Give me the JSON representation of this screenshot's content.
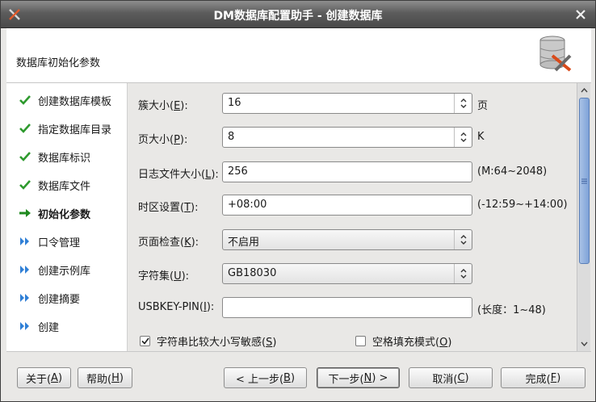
{
  "window": {
    "title": "DM数据库配置助手 - 创建数据库"
  },
  "header": {
    "title": "数据库初始化参数",
    "logo_icon": "database-config-icon"
  },
  "steps": [
    {
      "label": "创建数据库模板",
      "state": "done"
    },
    {
      "label": "指定数据库目录",
      "state": "done"
    },
    {
      "label": "数据库标识",
      "state": "done"
    },
    {
      "label": "数据库文件",
      "state": "done"
    },
    {
      "label": "初始化参数",
      "state": "current"
    },
    {
      "label": "口令管理",
      "state": "pending"
    },
    {
      "label": "创建示例库",
      "state": "pending"
    },
    {
      "label": "创建摘要",
      "state": "pending"
    },
    {
      "label": "创建",
      "state": "pending"
    }
  ],
  "form": {
    "extent_size": {
      "label": "簇大小(",
      "key": "E",
      "label_end": "):",
      "value": "16",
      "suffix": "页"
    },
    "page_size": {
      "label": "页大小(",
      "key": "P",
      "label_end": "):",
      "value": "8",
      "suffix": "K"
    },
    "log_size": {
      "label": "日志文件大小(",
      "key": "L",
      "label_end": "):",
      "value": "256",
      "suffix": "(M:64~2048)"
    },
    "time_zone": {
      "label": "时区设置(",
      "key": "T",
      "label_end": "):",
      "value": "+08:00",
      "suffix": "(-12:59~+14:00)"
    },
    "page_check": {
      "label": "页面检查(",
      "key": "K",
      "label_end": "):",
      "value": "不启用"
    },
    "charset": {
      "label": "字符集(",
      "key": "U",
      "label_end": "):",
      "value": "GB18030"
    },
    "usbkey_pin": {
      "label": "USBKEY-PIN(",
      "key": "I",
      "label_end": "):",
      "value": "",
      "suffix": "(长度：1~48)"
    },
    "case_sensitive": {
      "label": "字符串比较大小写敏感(",
      "key": "S",
      "label_end": ")",
      "checked": true
    },
    "blank_pad": {
      "label": "空格填充模式(",
      "key": "O",
      "label_end": ")",
      "checked": false
    }
  },
  "footer": {
    "about": {
      "label": "关于(",
      "key": "A",
      "label_end": ")"
    },
    "help": {
      "label": "帮助(",
      "key": "H",
      "label_end": ")"
    },
    "prev": {
      "label": "< 上一步(",
      "key": "B",
      "label_end": ")"
    },
    "next": {
      "label": "下一步(",
      "key": "N",
      "label_end": ") >"
    },
    "cancel": {
      "label": "取消(",
      "key": "C",
      "label_end": ")"
    },
    "finish": {
      "label": "完成(",
      "key": "F",
      "label_end": ")"
    }
  },
  "colors": {
    "done_check": "#2e9a2e",
    "pending_arrow": "#2f7fd6",
    "current_arrow": "#1f8a1f",
    "scroll_thumb": "#7fa3d8"
  }
}
